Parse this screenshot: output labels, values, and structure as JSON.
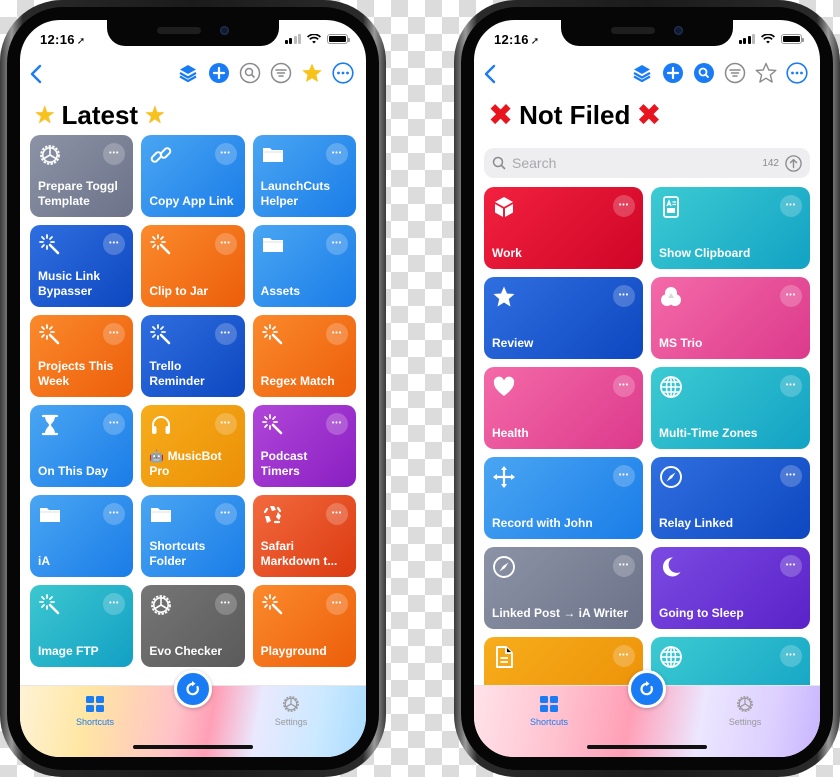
{
  "left": {
    "status": {
      "time": "12:16"
    },
    "title": "Latest",
    "title_emoji": "★",
    "nav": [
      "back",
      "layers",
      "add",
      "search",
      "filter",
      "favorites",
      "more"
    ],
    "tiles": [
      {
        "label": "Prepare Toggl\nTemplate",
        "icon": "gear-icon",
        "color": [
          "#8c93a6",
          "#6c7389"
        ]
      },
      {
        "label": "Copy App Link",
        "icon": "link-icon",
        "color": [
          "#4aa6f2",
          "#1a7ce8"
        ]
      },
      {
        "label": "LaunchCuts\nHelper",
        "icon": "folder-icon",
        "color": [
          "#4aa6f2",
          "#1a7ce8"
        ]
      },
      {
        "label": "Music Link\nBypasser",
        "icon": "magic-wand-icon",
        "color": [
          "#2f6fe0",
          "#0e47c0"
        ]
      },
      {
        "label": "Clip to Jar",
        "icon": "magic-wand-icon",
        "color": [
          "#fb8a2c",
          "#ec5e0a"
        ]
      },
      {
        "label": "Assets",
        "icon": "folder-icon",
        "color": [
          "#4aa6f2",
          "#1a7ce8"
        ]
      },
      {
        "label": "Projects This\nWeek",
        "icon": "magic-wand-icon",
        "color": [
          "#fb8a2c",
          "#ec5e0a"
        ]
      },
      {
        "label": "Trello\nReminder",
        "icon": "magic-wand-icon",
        "color": [
          "#2f6fe0",
          "#0e47c0"
        ]
      },
      {
        "label": "Regex Match",
        "icon": "magic-wand-icon",
        "color": [
          "#fb8a2c",
          "#ec5e0a"
        ]
      },
      {
        "label": "On This Day",
        "icon": "hourglass-icon",
        "color": [
          "#4aa6f2",
          "#1a7ce8"
        ]
      },
      {
        "label": "🤖 MusicBot\nPro",
        "icon": "headphones-icon",
        "color": [
          "#f6ad1c",
          "#ec8f06"
        ]
      },
      {
        "label": "Podcast\nTimers",
        "icon": "magic-wand-icon",
        "color": [
          "#b046d8",
          "#8a1fc2"
        ]
      },
      {
        "label": "iA",
        "icon": "folder-icon",
        "color": [
          "#4aa6f2",
          "#1a7ce8"
        ]
      },
      {
        "label": "Shortcuts\nFolder",
        "icon": "folder-icon",
        "color": [
          "#4aa6f2",
          "#1a7ce8"
        ]
      },
      {
        "label": "Safari\nMarkdown t...",
        "icon": "recycle-icon",
        "color": [
          "#f26a3e",
          "#dc3a10"
        ]
      },
      {
        "label": "Image FTP",
        "icon": "magic-wand-icon",
        "color": [
          "#3cc7cf",
          "#12a0c4"
        ]
      },
      {
        "label": "Evo Checker",
        "icon": "gear-icon",
        "color": [
          "#767676",
          "#5a5a5a"
        ]
      },
      {
        "label": "Playground",
        "icon": "magic-wand-icon",
        "color": [
          "#fb8a2c",
          "#ec5e0a"
        ]
      }
    ],
    "tabs": [
      {
        "label": "Shortcuts",
        "active": true
      },
      {
        "label": "Settings",
        "active": false
      }
    ]
  },
  "right": {
    "status": {
      "time": "12:16"
    },
    "title": "Not Filed",
    "title_emoji": "✖",
    "search": {
      "placeholder": "Search",
      "count": "142"
    },
    "tiles": [
      {
        "label": "Work",
        "icon": "cube-icon",
        "color": [
          "#f2213f",
          "#cf0527"
        ]
      },
      {
        "label": "Show Clipboard",
        "icon": "clipboard-icon",
        "color": [
          "#3ccbd2",
          "#12a2c4"
        ]
      },
      {
        "label": "Review",
        "icon": "star-icon",
        "color": [
          "#2f6fe0",
          "#0e47c0"
        ]
      },
      {
        "label": "MS Trio",
        "icon": "venn-icon",
        "color": [
          "#f46aa8",
          "#dc3a8c"
        ]
      },
      {
        "label": "Health",
        "icon": "heart-icon",
        "color": [
          "#f46aa8",
          "#dc3a8c"
        ]
      },
      {
        "label": "Multi-Time Zones",
        "icon": "globe-icon",
        "color": [
          "#3ccbd2",
          "#12a2c4"
        ]
      },
      {
        "label": "Record with John",
        "icon": "move-arrows-icon",
        "color": [
          "#4aa6f2",
          "#1a7ce8"
        ]
      },
      {
        "label": "Relay Linked",
        "icon": "compass-icon",
        "color": [
          "#2f6fe0",
          "#0e47c0"
        ]
      },
      {
        "label": "Linked Post → iA Writer",
        "icon": "compass-icon",
        "color": [
          "#8c93a6",
          "#6c7389"
        ]
      },
      {
        "label": "Going to Sleep",
        "icon": "moon-icon",
        "color": [
          "#7b4ae2",
          "#5a22c8"
        ]
      },
      {
        "label": "",
        "icon": "document-icon",
        "color": [
          "#f6ad1c",
          "#ec8f06"
        ]
      },
      {
        "label": "",
        "icon": "globe-icon",
        "color": [
          "#3ccbd2",
          "#12a2c4"
        ]
      }
    ],
    "tabs": [
      {
        "label": "Shortcuts",
        "active": true
      },
      {
        "label": "Settings",
        "active": false
      }
    ]
  },
  "colors": {
    "accent": "#1a7cf5",
    "favorite": "#f7c21c",
    "inactive": "#999999"
  }
}
